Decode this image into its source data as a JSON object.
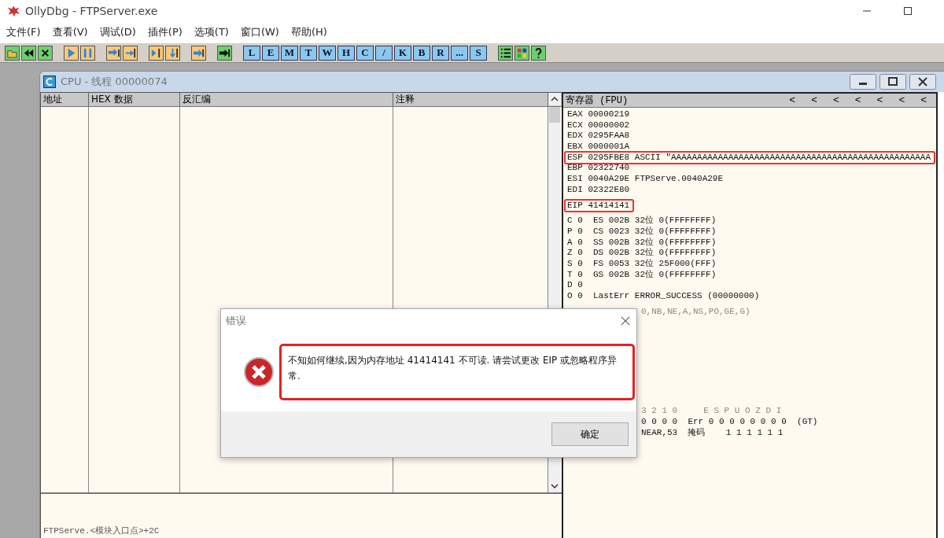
{
  "window": {
    "title": "OllyDbg - FTPServer.exe"
  },
  "menu": [
    {
      "label": "文件(F)"
    },
    {
      "label": "查看(V)"
    },
    {
      "label": "调试(D)"
    },
    {
      "label": "插件(P)"
    },
    {
      "label": "选项(T)"
    },
    {
      "label": "窗口(W)"
    },
    {
      "label": "帮助(H)"
    }
  ],
  "toolbar": {
    "letter_buttons": [
      "L",
      "E",
      "M",
      "T",
      "W",
      "H",
      "C",
      "/",
      "K",
      "B",
      "R",
      "...",
      "S"
    ]
  },
  "cpu_window": {
    "title": "CPU - 线程 00000074",
    "columns": [
      "地址",
      "HEX 数据",
      "反汇编",
      "注释"
    ],
    "info_text": "FTPServe.<模块入口点>+2C",
    "registers": {
      "header": "寄存器 (FPU)",
      "arrows": [
        "<",
        "<",
        "<",
        "<",
        "<",
        "<",
        "<"
      ],
      "sections": [
        {
          "lines": [
            {
              "text": "EAX 00000219",
              "highlighted": false,
              "dim": false
            },
            {
              "text": "ECX 00000002",
              "highlighted": false,
              "dim": false
            },
            {
              "text": "EDX 0295FAA8",
              "highlighted": false,
              "dim": false
            },
            {
              "text": "EBX 0000001A",
              "highlighted": false,
              "dim": false
            },
            {
              "text": "ESP 0295FBE8 ASCII \"AAAAAAAAAAAAAAAAAAAAAAAAAAAAAAAAAAAAAAAAAAAAAAAAAA",
              "highlighted": true,
              "dim": false
            },
            {
              "text": "EBP 02322740",
              "highlighted": false,
              "dim": false
            },
            {
              "text": "ESI 0040A29E FTPServe.0040A29E",
              "highlighted": false,
              "dim": false
            },
            {
              "text": "EDI 02322E80",
              "highlighted": false,
              "dim": false
            }
          ]
        },
        {
          "lines": [
            {
              "text": "EIP 41414141",
              "highlighted": true,
              "dim": false
            }
          ]
        },
        {
          "lines": [
            {
              "text": "C 0  ES 002B 32位 0(FFFFFFFF)",
              "highlighted": false,
              "dim": false
            },
            {
              "text": "P 0  CS 0023 32位 0(FFFFFFFF)",
              "highlighted": false,
              "dim": false
            },
            {
              "text": "A 0  SS 002B 32位 0(FFFFFFFF)",
              "highlighted": false,
              "dim": false
            },
            {
              "text": "Z 0  DS 002B 32位 0(FFFFFFFF)",
              "highlighted": false,
              "dim": false
            },
            {
              "text": "S 0  FS 0053 32位 25F000(FFF)",
              "highlighted": false,
              "dim": false
            },
            {
              "text": "T 0  GS 002B 32位 0(FFFFFFFF)",
              "highlighted": false,
              "dim": false
            },
            {
              "text": "D 0",
              "highlighted": false,
              "dim": false
            },
            {
              "text": "O 0  LastErr ERROR_SUCCESS (00000000)",
              "highlighted": false,
              "dim": false
            }
          ]
        }
      ],
      "partial_sections": [
        {
          "lines": [
            {
              "text": "0,NB,NE,A,NS,PO,GE,G)",
              "dim": true
            }
          ]
        },
        {
          "lines": [
            {
              "text": "3 2 1 0     E S P U O Z D I",
              "dim": true
            },
            {
              "text": "0 0 0 0  Err 0 0 0 0 0 0 0 0  (GT)",
              "dim": false
            },
            {
              "text": "NEAR,53  掩码    1 1 1 1 1 1",
              "dim": false
            }
          ]
        }
      ]
    }
  },
  "dialog": {
    "title": "错误",
    "message": "不知如何继续,因为内存地址 41414141 不可读. 请尝试更改 EIP 或忽略程序异常.",
    "highlighted": true,
    "button": "确定"
  }
}
